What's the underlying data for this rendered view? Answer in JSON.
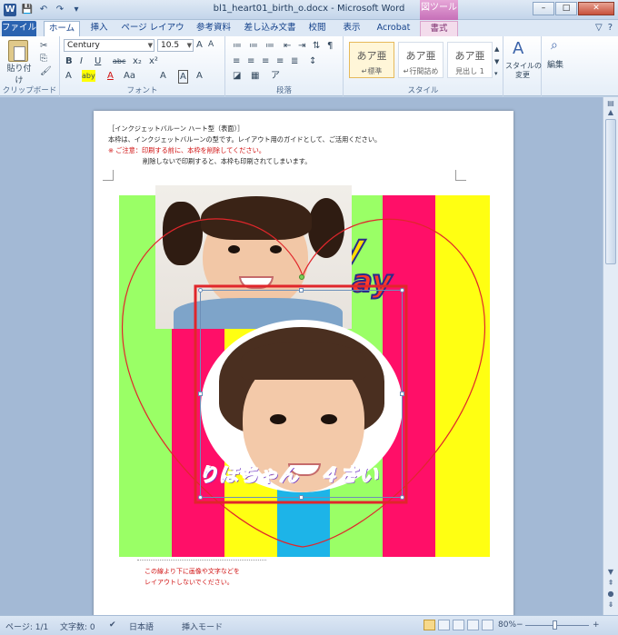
{
  "window": {
    "title": "bl1_heart01_birth_o.docx  -  Microsoft Word",
    "app_icon": "W",
    "context_tool": "図ツール",
    "controls": [
      "–",
      "□",
      "✕"
    ]
  },
  "qat": [
    "save-icon",
    "undo-icon",
    "redo-icon",
    "customize-icon"
  ],
  "qat_glyphs": [
    "💾",
    "↶",
    "↷",
    "▾"
  ],
  "tabs": [
    {
      "label": "ファイル",
      "kind": "file"
    },
    {
      "label": "ホーム",
      "kind": "active"
    },
    {
      "label": "挿入",
      "kind": "normal"
    },
    {
      "label": "ページ レイアウト",
      "kind": "normal"
    },
    {
      "label": "参考資料",
      "kind": "normal"
    },
    {
      "label": "差し込み文書",
      "kind": "normal"
    },
    {
      "label": "校閲",
      "kind": "normal"
    },
    {
      "label": "表示",
      "kind": "normal"
    },
    {
      "label": "Acrobat",
      "kind": "normal"
    },
    {
      "label": "書式",
      "kind": "ctx"
    }
  ],
  "tab_right": [
    "▽",
    "?"
  ],
  "ribbon": {
    "clipboard": {
      "paste_label": "貼り付け",
      "group_label": "クリップボード"
    },
    "font": {
      "font_name": "Century",
      "font_size": "10.5",
      "group_label": "フォント",
      "row2": [
        "B",
        "I",
        "U",
        "abc",
        "x₂",
        "x²"
      ],
      "row3": [
        "A",
        "aby",
        "A",
        "Aa",
        "A",
        "A",
        "A"
      ],
      "row1_extra": [
        "A",
        "A",
        "Aa",
        "A"
      ]
    },
    "paragraph": {
      "group_label": "段落",
      "row1": [
        "≔",
        "≔",
        "≔",
        "⇤",
        "⇥",
        "⇅",
        "¶"
      ],
      "row2": [
        "≡",
        "≡",
        "≡",
        "≡",
        "≣",
        "↕"
      ],
      "row3": [
        "◪",
        "▦",
        "ア"
      ]
    },
    "styles": {
      "group_label": "スタイル",
      "boxes": [
        {
          "sample": "あア亜",
          "name": "↵標準"
        },
        {
          "sample": "あア亜",
          "name": "↵行間詰め"
        },
        {
          "sample": "あア亜",
          "name": "見出し 1"
        }
      ],
      "change_label": "スタイルの\n変更"
    },
    "edit": {
      "label": "編集"
    }
  },
  "document": {
    "lines": [
      {
        "text": "［インクジェットバルーン ハート型（表面）］",
        "color": "black"
      },
      {
        "text": "本枠は、インクジェットバルーンの型です。レイアウト用のガイドとして、ご活用ください。",
        "color": "black"
      },
      {
        "text": "※ ご注意：印刷する前に、本枠を削除してください。",
        "color": "red"
      },
      {
        "text": "削除しないで印刷すると、本枠も印刷されてしまいます。",
        "color": "black"
      }
    ],
    "name_text": "りほちゃん　４さい",
    "logo_text": [
      "y",
      "ay"
    ],
    "notes": [
      "この線より下に画像や文字などを",
      "レイアウトしないでください。"
    ]
  },
  "status": {
    "page": "ページ: 1/1",
    "words": "文字数: 0",
    "lang": "日本語",
    "mode": "挿入モード",
    "zoom": "80%",
    "zoom_minus": "−",
    "zoom_plus": "+"
  },
  "colors": {
    "stripe_green": "#9aff66",
    "stripe_pink": "#ff0f68",
    "stripe_yellow": "#ffff12",
    "stripe_blue": "#1db4e8",
    "heart_line": "#e0262b",
    "name_purple": "#9b5cf0"
  },
  "stripes": [
    "#9aff66",
    "#ff0f68",
    "#ffff12",
    "#1db4e8",
    "#9aff66",
    "#ff0f68",
    "#ffff12"
  ]
}
